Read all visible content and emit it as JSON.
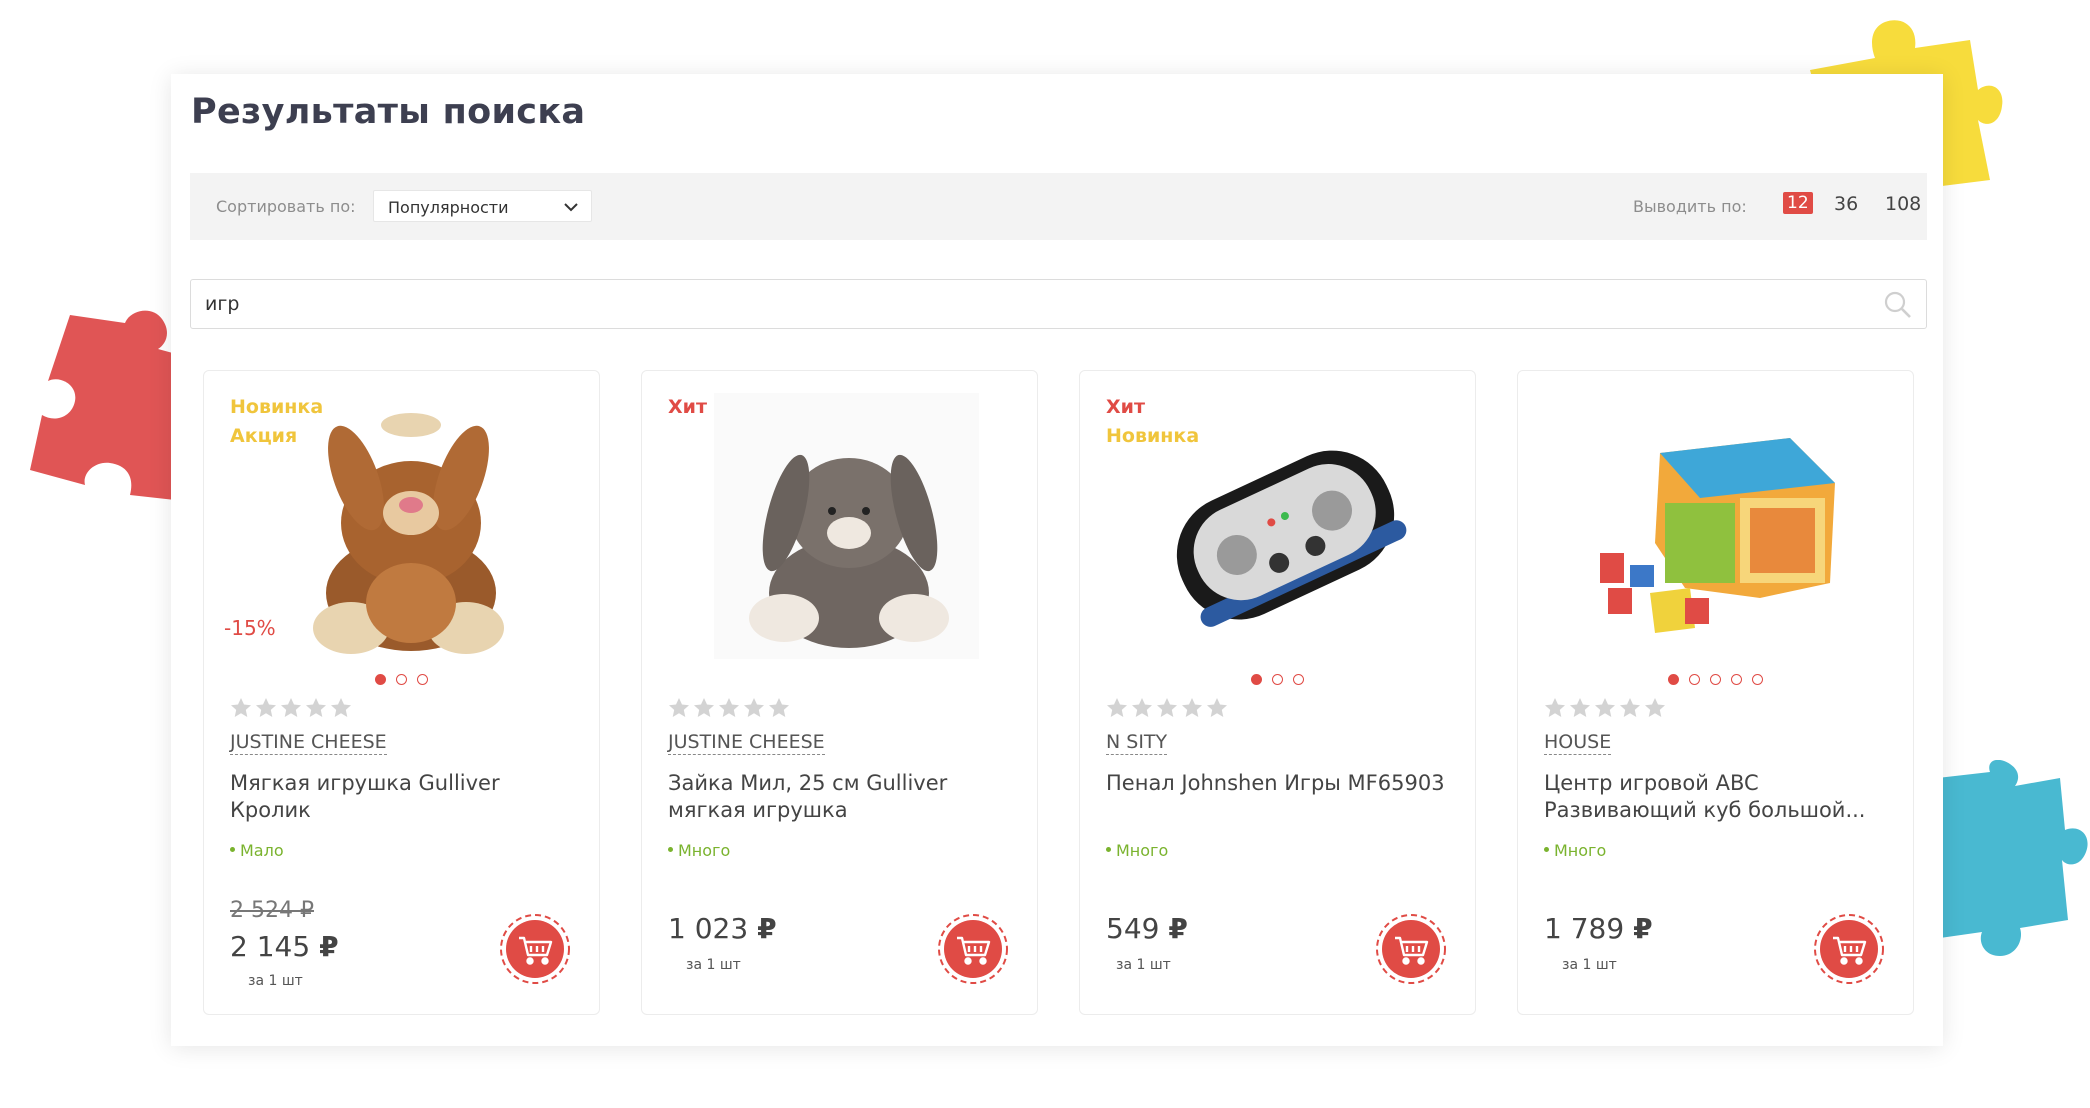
{
  "page": {
    "title": "Результаты поиска"
  },
  "sort": {
    "label": "Сортировать по:",
    "value": "Популярности"
  },
  "perpage": {
    "label": "Выводить по:",
    "options": [
      "12",
      "36",
      "108"
    ],
    "active": "12"
  },
  "search": {
    "value": "игр"
  },
  "colors": {
    "accent": "#e04b45",
    "badge_yellow": "#f0c53c",
    "stock_green": "#7ab32e",
    "title": "#3d3f50"
  },
  "products": [
    {
      "badges": [
        "Новинка",
        "Акция"
      ],
      "discount": "-15%",
      "image": "plush-bunny-brown",
      "dots_active": 0,
      "dots_count": 3,
      "rating": 0,
      "brand": "JUSTINE CHEESE",
      "name": "Мягкая игрушка Gulliver Кролик",
      "stock": "Мало",
      "old_price": "2 524",
      "price": "2 145",
      "currency": "₽",
      "unit": "за 1 шт"
    },
    {
      "badges": [
        "Хит"
      ],
      "image": "plush-bunny-grey",
      "dots_count": 0,
      "rating": 0,
      "brand": "JUSTINE CHEESE",
      "name": "Зайка Мил, 25 см Gulliver мягкая игрушка",
      "stock": "Много",
      "price": "1 023",
      "currency": "₽",
      "unit": "за 1 шт"
    },
    {
      "badges": [
        "Хит",
        "Новинка"
      ],
      "image": "gamepad-case",
      "dots_active": 0,
      "dots_count": 3,
      "rating": 0,
      "brand": "N SITY",
      "name": "Пенал Johnshen Игры MF65903",
      "stock": "Много",
      "price": "549",
      "currency": "₽",
      "unit": "за 1 шт"
    },
    {
      "badges": [],
      "image": "activity-cube",
      "dots_active": 0,
      "dots_count": 5,
      "rating": 0,
      "brand": "HOUSE",
      "name": "Центр игровой ABC Развивающий куб большой...",
      "stock": "Много",
      "price": "1 789",
      "currency": "₽",
      "unit": "за 1 шт"
    }
  ]
}
